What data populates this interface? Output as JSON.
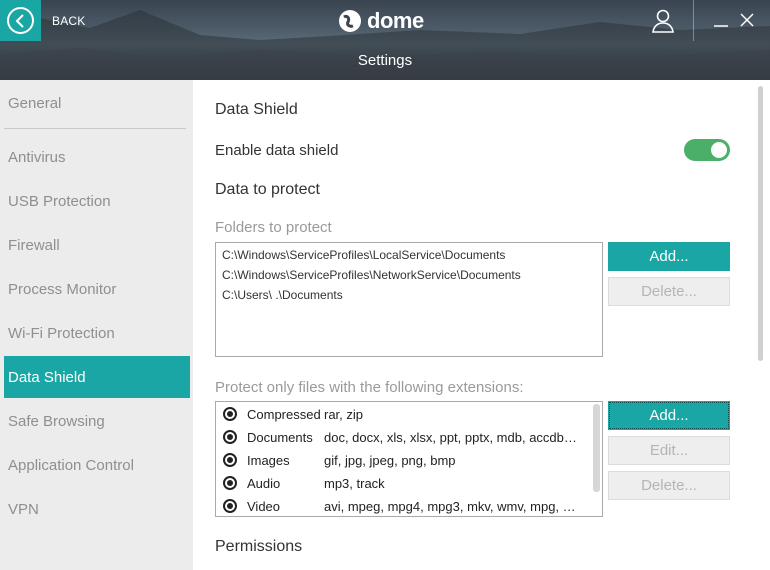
{
  "header": {
    "back_label": "BACK",
    "logo_text": "dome",
    "title": "Settings"
  },
  "sidebar": {
    "items": [
      {
        "label": "General"
      },
      {
        "label": "Antivirus"
      },
      {
        "label": "USB Protection"
      },
      {
        "label": "Firewall"
      },
      {
        "label": "Process Monitor"
      },
      {
        "label": "Wi-Fi Protection"
      },
      {
        "label": "Data Shield",
        "active": true
      },
      {
        "label": "Safe Browsing"
      },
      {
        "label": "Application Control"
      },
      {
        "label": "VPN"
      }
    ]
  },
  "main": {
    "section_title": "Data Shield",
    "enable_label": "Enable data shield",
    "enable_on": true,
    "data_to_protect": "Data to protect",
    "folders_label": "Folders to protect",
    "folders": [
      "C:\\Windows\\ServiceProfiles\\LocalService\\Documents",
      "C:\\Windows\\ServiceProfiles\\NetworkService\\Documents",
      "C:\\Users\\      .\\Documents"
    ],
    "folder_buttons": {
      "add": "Add...",
      "delete": "Delete..."
    },
    "extensions_label": "Protect only files with the following extensions:",
    "extensions": [
      {
        "name": "Compressed",
        "types": "rar, zip"
      },
      {
        "name": "Documents",
        "types": "doc, docx, xls, xlsx, ppt, pptx, mdb, accdb, p..."
      },
      {
        "name": "Images",
        "types": "gif, jpg, jpeg, png, bmp"
      },
      {
        "name": "Audio",
        "types": "mp3, track"
      },
      {
        "name": "Video",
        "types": "avi, mpeg, mpg4, mpg3, mkv, wmv, mpg, mp4"
      }
    ],
    "extension_buttons": {
      "add": "Add...",
      "edit": "Edit...",
      "delete": "Delete..."
    },
    "permissions": "Permissions"
  },
  "colors": {
    "accent": "#1aa6a4",
    "toggle_on": "#4caf69"
  }
}
